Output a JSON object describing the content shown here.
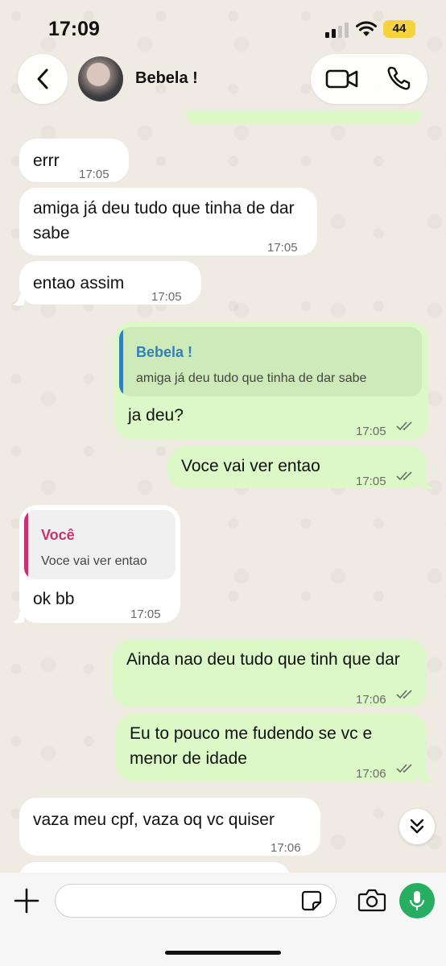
{
  "status_bar": {
    "time": "17:09",
    "battery": "44"
  },
  "header": {
    "contact_name": "Bebela !"
  },
  "messages": [
    {
      "direction": "in",
      "text": "errr",
      "time": "17:05"
    },
    {
      "direction": "in",
      "text": "amiga já deu tudo que tinha de dar sabe",
      "time": "17:05"
    },
    {
      "direction": "in",
      "text": "entao assim",
      "time": "17:05"
    },
    {
      "direction": "out",
      "quote_name": "Bebela !",
      "quote_text": "amiga já deu tudo que tinha de dar sabe",
      "text": "ja deu?",
      "time": "17:05"
    },
    {
      "direction": "out",
      "text": "Voce vai ver entao",
      "time": "17:05"
    },
    {
      "direction": "in",
      "quote_name": "Você",
      "quote_text": "Voce vai ver entao",
      "text": "ok bb",
      "time": "17:05"
    },
    {
      "direction": "out",
      "text": "Ainda nao deu tudo que tinh que dar",
      "time": "17:06"
    },
    {
      "direction": "out",
      "text": "Eu to pouco me fudendo se vc e menor de idade",
      "time": "17:06"
    },
    {
      "direction": "in",
      "text": "vaza meu cpf, vaza oq vc quiser",
      "time": "17:06"
    }
  ],
  "input": {
    "placeholder": ""
  },
  "colors": {
    "incoming_bubble": "#ffffff",
    "outgoing_bubble": "#dbf8c6",
    "quote_name_contact": "#2f80b8",
    "quote_name_self": "#c8326e",
    "accent_green": "#27ae60",
    "read_ticks": "#6b6b6b"
  },
  "icons": [
    "back-icon",
    "video-call-icon",
    "phone-icon",
    "plus-icon",
    "sticker-icon",
    "camera-icon",
    "mic-icon",
    "chevron-double-down-icon",
    "double-check-icon"
  ]
}
